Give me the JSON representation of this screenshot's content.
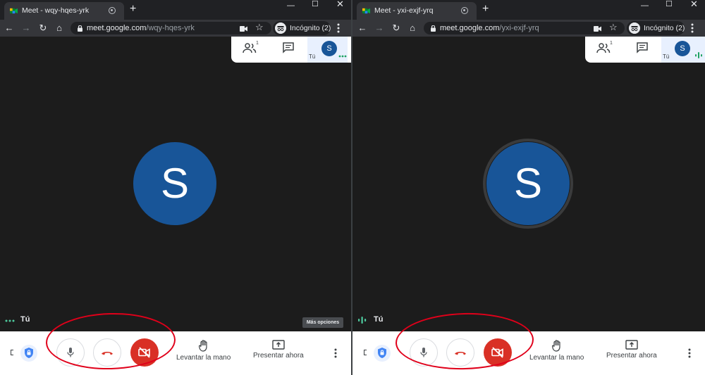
{
  "windows": [
    {
      "tab_title": "Meet - wqy-hqes-yrk",
      "url_host": "meet.google.com",
      "url_path": "/wqy-hqes-yrk",
      "incognito_label": "Incógnito (2)",
      "participants_count": "1",
      "self_panel_label": "Tú",
      "avatar_initial": "S",
      "self_video_label": "Tú",
      "tooltip": "Más opciones",
      "raise_hand_label": "Levantar la mano",
      "present_label": "Presentar ahora",
      "speaking": false
    },
    {
      "tab_title": "Meet - yxi-exjf-yrq",
      "url_host": "meet.google.com",
      "url_path": "/yxi-exjf-yrq",
      "incognito_label": "Incógnito (2)",
      "participants_count": "1",
      "self_panel_label": "Tú",
      "avatar_initial": "S",
      "self_video_label": "Tú",
      "raise_hand_label": "Levantar la mano",
      "present_label": "Presentar ahora",
      "speaking": true
    }
  ],
  "colors": {
    "meet_blue": "#185598",
    "end_call_red": "#d93025",
    "annotation_red": "#e0001a",
    "speaking_teal": "#1ea362"
  },
  "icons": [
    "meet-logo-icon",
    "lock-icon",
    "camera-icon",
    "star-icon",
    "incognito-icon",
    "people-icon",
    "chat-icon",
    "shield-icon",
    "mic-icon",
    "hang-up-icon",
    "camera-off-icon",
    "raise-hand-icon",
    "present-icon",
    "more-options-icon"
  ]
}
